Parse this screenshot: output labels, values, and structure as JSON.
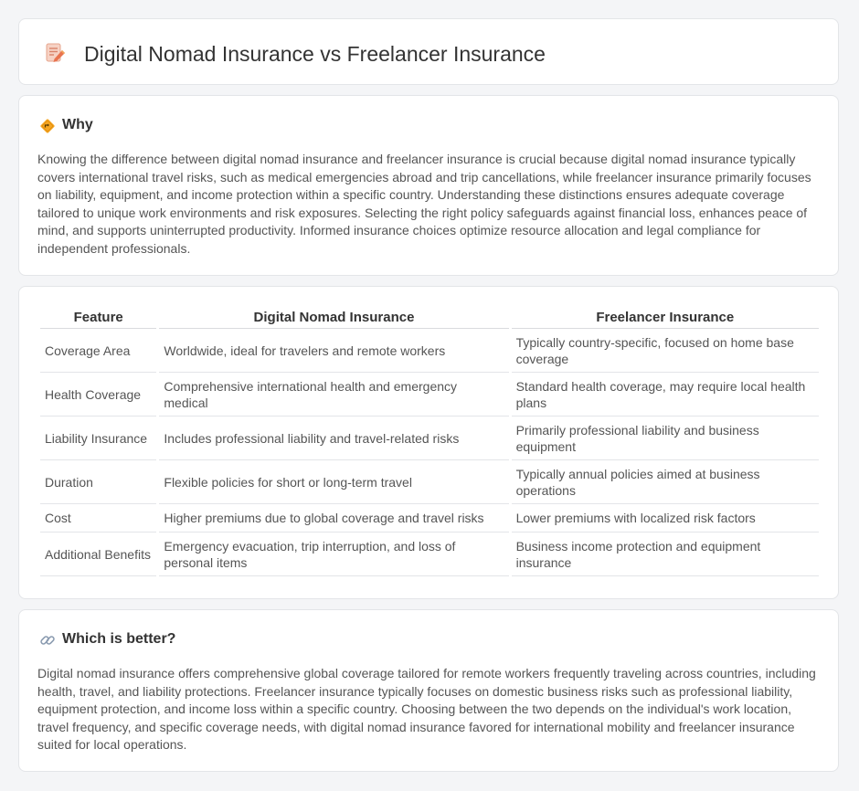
{
  "header": {
    "title": "Digital Nomad Insurance vs Freelancer Insurance",
    "icon": "document-pen-icon"
  },
  "why": {
    "heading": "Why",
    "icon": "diamond-sign-icon",
    "text": "Knowing the difference between digital nomad insurance and freelancer insurance is crucial because digital nomad insurance typically covers international travel risks, such as medical emergencies abroad and trip cancellations, while freelancer insurance primarily focuses on liability, equipment, and income protection within a specific country. Understanding these distinctions ensures adequate coverage tailored to unique work environments and risk exposures. Selecting the right policy safeguards against financial loss, enhances peace of mind, and supports uninterrupted productivity. Informed insurance choices optimize resource allocation and legal compliance for independent professionals."
  },
  "table": {
    "headers": [
      "Feature",
      "Digital Nomad Insurance",
      "Freelancer Insurance"
    ],
    "rows": [
      [
        "Coverage Area",
        "Worldwide, ideal for travelers and remote workers",
        "Typically country-specific, focused on home base coverage"
      ],
      [
        "Health Coverage",
        "Comprehensive international health and emergency medical",
        "Standard health coverage, may require local health plans"
      ],
      [
        "Liability Insurance",
        "Includes professional liability and travel-related risks",
        "Primarily professional liability and business equipment"
      ],
      [
        "Duration",
        "Flexible policies for short or long-term travel",
        "Typically annual policies aimed at business operations"
      ],
      [
        "Cost",
        "Higher premiums due to global coverage and travel risks",
        "Lower premiums with localized risk factors"
      ],
      [
        "Additional Benefits",
        "Emergency evacuation, trip interruption, and loss of personal items",
        "Business income protection and equipment insurance"
      ]
    ]
  },
  "better": {
    "heading": "Which is better?",
    "icon": "link-icon",
    "text": "Digital nomad insurance offers comprehensive global coverage tailored for remote workers frequently traveling across countries, including health, travel, and liability protections. Freelancer insurance typically focuses on domestic business risks such as professional liability, equipment protection, and income loss within a specific country. Choosing between the two depends on the individual's work location, travel frequency, and specific coverage needs, with digital nomad insurance favored for international mobility and freelancer insurance suited for local operations."
  }
}
